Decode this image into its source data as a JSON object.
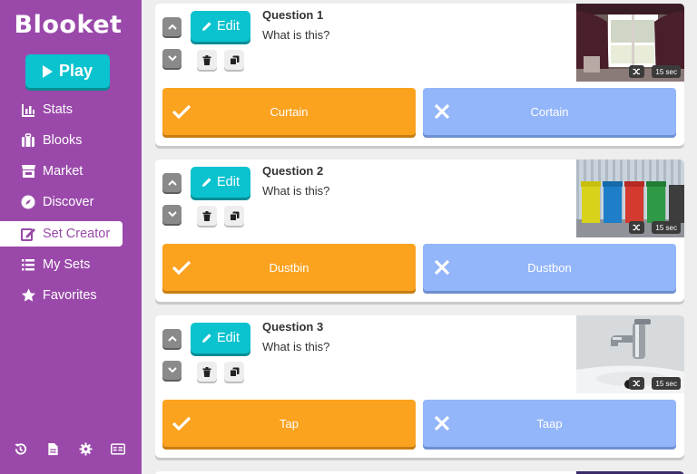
{
  "sidebar": {
    "logo": "Blooket",
    "play_label": "Play",
    "items": [
      {
        "label": "Stats",
        "icon": "chart-icon",
        "active": false
      },
      {
        "label": "Blooks",
        "icon": "briefcase-icon",
        "active": false
      },
      {
        "label": "Market",
        "icon": "store-icon",
        "active": false
      },
      {
        "label": "Discover",
        "icon": "compass-icon",
        "active": false
      },
      {
        "label": "Set Creator",
        "icon": "edit-icon",
        "active": true
      },
      {
        "label": "My Sets",
        "icon": "list-icon",
        "active": false
      },
      {
        "label": "Favorites",
        "icon": "star-icon",
        "active": false
      }
    ],
    "bottom_icons": [
      "history-icon",
      "document-icon",
      "gear-icon",
      "id-card-icon"
    ]
  },
  "colors": {
    "sidebar": "#9a49aa",
    "accent": "#0bc2cf",
    "correct": "#fba21f",
    "wrong": "#93b5fa"
  },
  "questions": [
    {
      "title": "Question 1",
      "text": "What is this?",
      "edit_label": "Edit",
      "time": "15 sec",
      "image": "curtain-window-photo",
      "correct_answer": "Curtain",
      "wrong_answer": "Cortain"
    },
    {
      "title": "Question 2",
      "text": "What is this?",
      "edit_label": "Edit",
      "time": "15 sec",
      "image": "recycling-bins-photo",
      "correct_answer": "Dustbin",
      "wrong_answer": "Dustbon"
    },
    {
      "title": "Question 3",
      "text": "What is this?",
      "edit_label": "Edit",
      "time": "15 sec",
      "image": "faucet-photo",
      "correct_answer": "Tap",
      "wrong_answer": "Taap"
    }
  ]
}
